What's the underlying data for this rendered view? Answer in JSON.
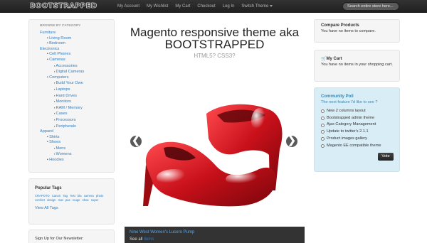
{
  "navbar": {
    "brand": "BOOTSTRAPPED",
    "links": [
      "My Account",
      "My Wishlist",
      "My Cart",
      "Checkout",
      "Log In"
    ],
    "switch_theme": "Switch Theme",
    "search_placeholder": "Search entire store here..."
  },
  "categories": {
    "heading": "BROWSE BY CATEGORY",
    "furniture": {
      "label": "Furniture",
      "children": [
        "Living Room",
        "Bedroom"
      ]
    },
    "electronics": {
      "label": "Electronics",
      "cell_phones": "Cell Phones",
      "cameras": {
        "label": "Cameras",
        "children": [
          "Accessories",
          "Digital Cameras"
        ]
      },
      "computers": {
        "label": "Computers",
        "children": [
          "Build Your Own",
          "Laptops",
          "Hard Drives",
          "Monitors",
          "RAM / Memory",
          "Cases",
          "Processors",
          "Peripherals"
        ]
      }
    },
    "apparel": {
      "label": "Apparel",
      "shirts": "Shirts",
      "shoes": {
        "label": "Shoes",
        "children": [
          "Mens",
          "Womens"
        ]
      },
      "hoodies": "Hoodies"
    }
  },
  "tags": {
    "title": "Popular Tags",
    "items": [
      "CRAPOTO",
      "Canon",
      "Tag",
      "Test",
      "bla",
      "camera",
      "photo",
      "comfort",
      "design",
      "mat",
      "pas",
      "rouge",
      "shoe",
      "super"
    ],
    "view_all": "View All Tags"
  },
  "newsletter": {
    "label": "Sign Up for Our Newsletter:"
  },
  "hero": {
    "title": "Magento responsive theme aka BOOTSTRAPPED",
    "subtitle": "HTML5? CSS3?"
  },
  "carousel": {
    "prev": "❮",
    "next": "❯",
    "caption_title": "Nine West Women's Lucero Pump",
    "caption_more_prefix": "See all",
    "caption_more_link": "items",
    "shoe_color": "#d0101a"
  },
  "compare": {
    "title": "Compare Products",
    "text": "You have no items to compare."
  },
  "cart": {
    "title": "My Cart",
    "text": "You have no items in your shopping cart."
  },
  "poll": {
    "title": "Community Poll",
    "question": "The next feature I'd like to see ?",
    "options": [
      "New 2 columns layout",
      "Bootstrapped admin theme",
      "Ajax Category Management",
      "Update to twitter's 2.1.1",
      "Product images gallery",
      "Magento EE compatible theme"
    ],
    "vote": "Vote"
  }
}
